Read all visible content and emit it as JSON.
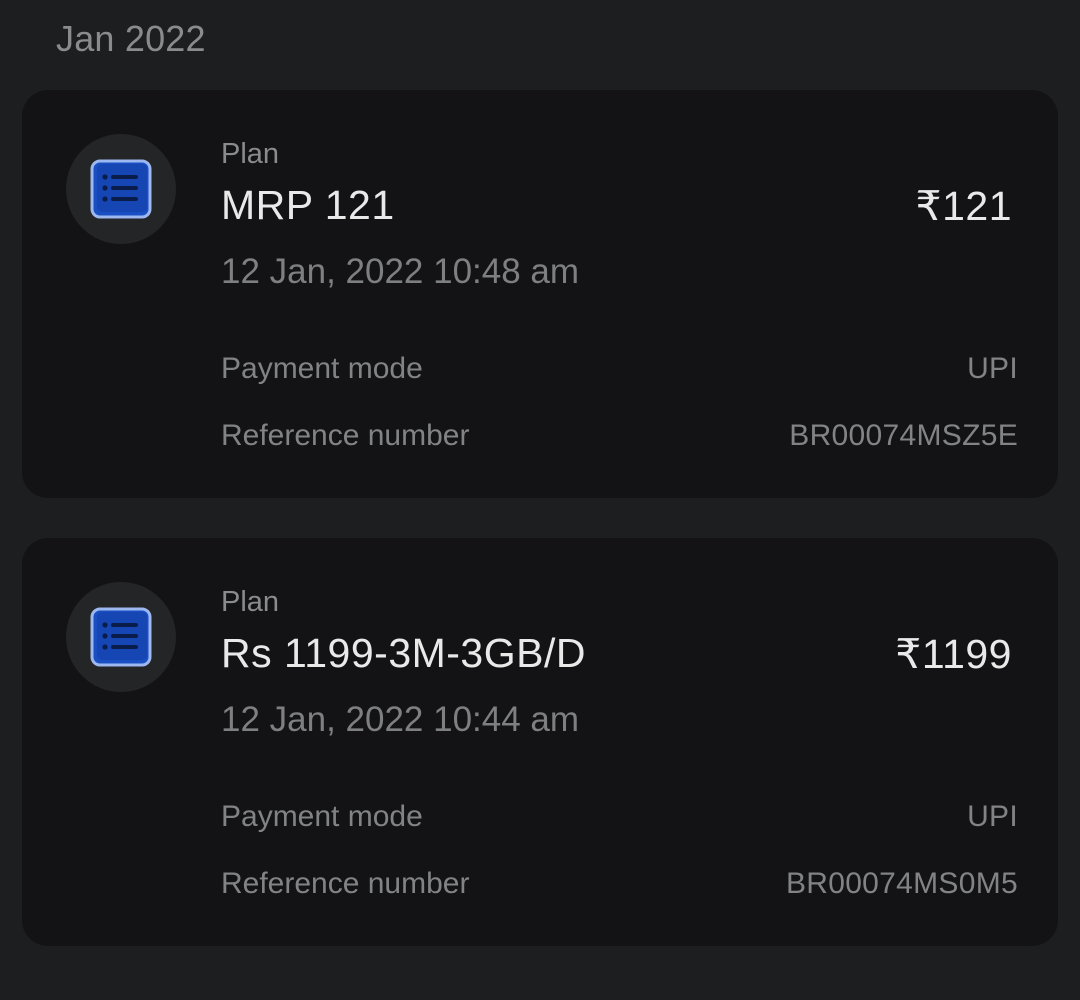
{
  "month_header": "Jan 2022",
  "colors": {
    "background": "#1d1e20",
    "card": "#131315",
    "icon_blue": "#1a4fc4",
    "icon_outline": "#9db8f0"
  },
  "transactions": [
    {
      "icon": "list-icon",
      "caption": "Plan",
      "plan_name": "MRP 121",
      "amount": "₹121",
      "timestamp": "12 Jan, 2022 10:48 am",
      "payment_mode_label": "Payment mode",
      "payment_mode": "UPI",
      "reference_label": "Reference number",
      "reference_number": "BR00074MSZ5E"
    },
    {
      "icon": "list-icon",
      "caption": "Plan",
      "plan_name": "Rs 1199-3M-3GB/D",
      "amount": "₹1199",
      "timestamp": "12 Jan, 2022 10:44 am",
      "payment_mode_label": "Payment mode",
      "payment_mode": "UPI",
      "reference_label": "Reference number",
      "reference_number": "BR00074MS0M5"
    }
  ]
}
